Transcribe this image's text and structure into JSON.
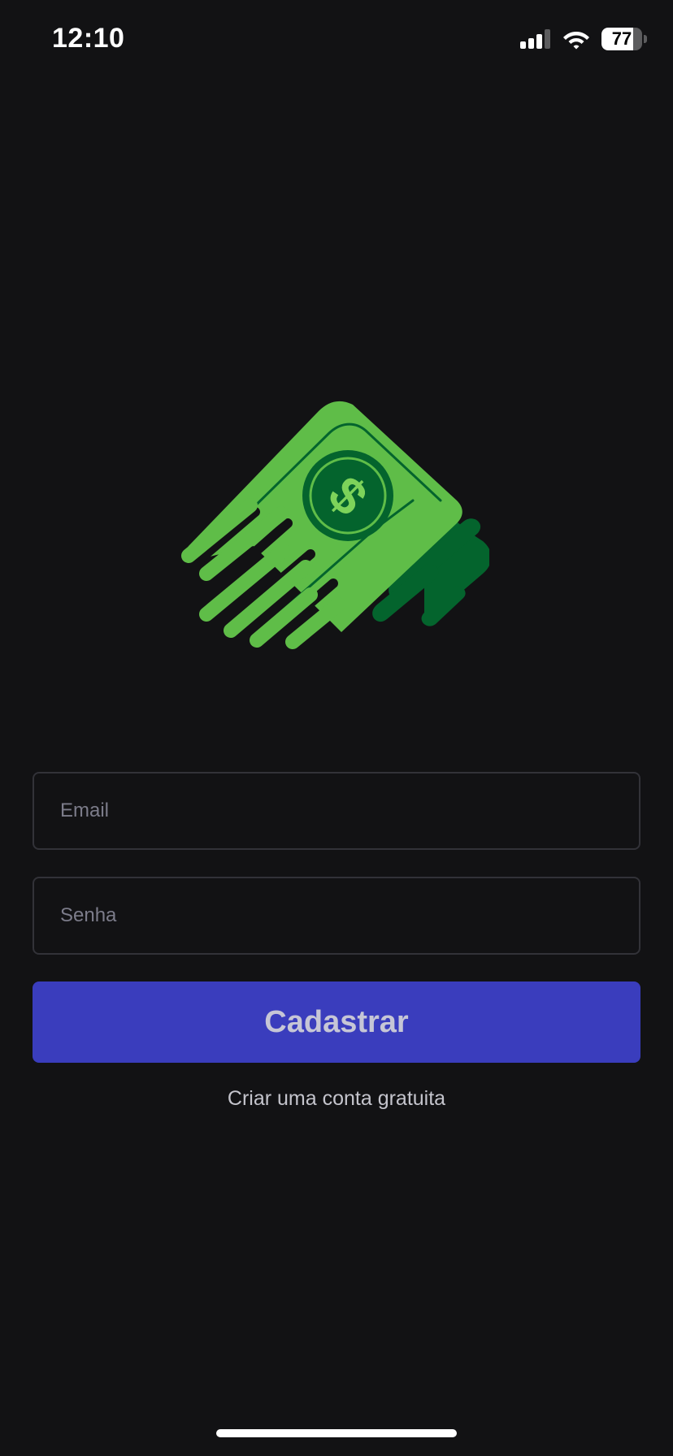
{
  "status_bar": {
    "time": "12:10",
    "battery_percent": "77",
    "battery_level": 0.77,
    "icons": [
      "signal-icon",
      "wifi-icon",
      "battery-icon"
    ]
  },
  "logo": {
    "icon": "flying-money-icon",
    "colors": {
      "light_green": "#5fbd48",
      "dark_green": "#04642d",
      "coin_text": "#7dd35a"
    }
  },
  "form": {
    "email_placeholder": "Email",
    "password_placeholder": "Senha",
    "submit_label": "Cadastrar",
    "create_account_label": "Criar uma conta gratuita"
  },
  "colors": {
    "background": "#121214",
    "input_border": "#323238",
    "button": "#3a3dbd",
    "button_text": "#c6c6d6"
  }
}
